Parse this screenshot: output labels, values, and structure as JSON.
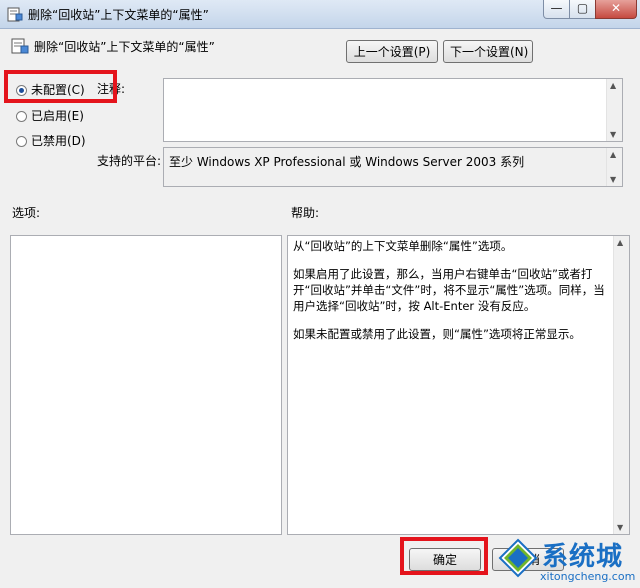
{
  "window": {
    "title": "删除“回收站”上下文菜单的“属性”",
    "minimize_glyph": "—",
    "maximize_glyph": "▢",
    "close_glyph": "✕"
  },
  "header": {
    "policy_title": "删除“回收站”上下文菜单的“属性”",
    "prev_setting": "上一个设置(P)",
    "next_setting": "下一个设置(N)"
  },
  "state": {
    "options": [
      {
        "label": "未配置(C)",
        "selected": true
      },
      {
        "label": "已启用(E)",
        "selected": false
      },
      {
        "label": "已禁用(D)",
        "selected": false
      }
    ]
  },
  "comment": {
    "label": "注释:",
    "value": ""
  },
  "platform": {
    "label": "支持的平台:",
    "value": "至少 Windows XP Professional 或 Windows Server 2003 系列"
  },
  "options_section": {
    "label": "选项:"
  },
  "help_section": {
    "label": "帮助:",
    "paragraphs": [
      "从“回收站”的上下文菜单删除“属性”选项。",
      "如果启用了此设置，那么，当用户右键单击“回收站”或者打开“回收站”并单击“文件”时，将不显示“属性”选项。同样，当用户选择“回收站”时，按 Alt-Enter 没有反应。",
      "如果未配置或禁用了此设置，则“属性”选项将正常显示。"
    ]
  },
  "footer": {
    "ok": "确定",
    "cancel": "取消"
  },
  "watermark": {
    "brand": "系统城",
    "url": "xitongcheng.com"
  },
  "colors": {
    "highlight_box": "#e4141c",
    "accent": "#1a6fc4"
  }
}
